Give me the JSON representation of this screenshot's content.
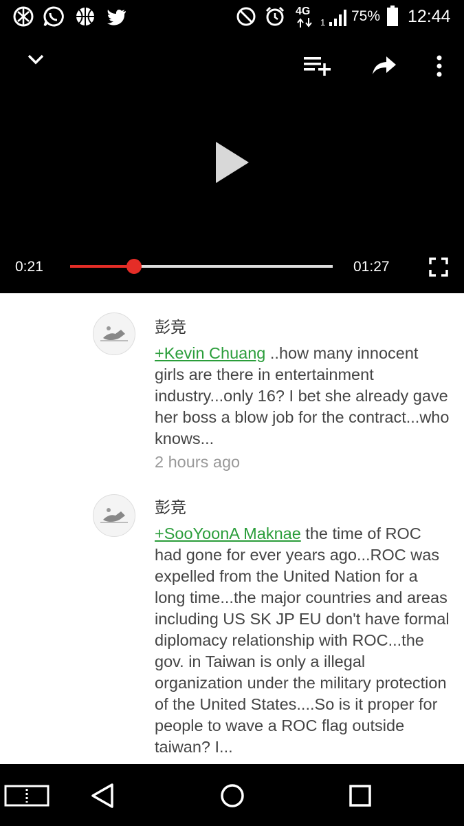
{
  "status_bar": {
    "left_icons": [
      "dribbble-style-app-icon",
      "whatsapp-icon",
      "basketball-icon",
      "twitter-icon"
    ],
    "right_icons": [
      "do-not-disturb-icon",
      "alarm-icon",
      "network-4g-icon",
      "signal-icon",
      "battery-icon"
    ],
    "network": "4G",
    "sim_slot": "1",
    "battery": "75%",
    "time": "12:44"
  },
  "player": {
    "elapsed": "0:21",
    "duration": "01:27",
    "progress": 0.244,
    "accent_color": "#e52d27"
  },
  "comments": [
    {
      "author": "彭竞",
      "mention": "+Kevin Chuang",
      "text": " ..how many innocent girls are there in entertainment industry...only 16?  I bet she already gave her boss a blow job for the contract...who knows...",
      "time": "2 hours ago"
    },
    {
      "author": "彭竞",
      "mention": "+SooYoonA Maknae",
      "text": " the time of ROC had gone for ever years ago...ROC was expelled from the United Nation for a long time...the major countries and areas including  US SK JP EU don't have formal diplomacy relationship with ROC...the gov. in Taiwan is only a illegal organization under the military protection of the United States....So is it proper for people to wave a ROC flag outside taiwan?  I..."
    }
  ],
  "colors": {
    "mention": "#2a9d3a",
    "timestamp": "#999999"
  }
}
